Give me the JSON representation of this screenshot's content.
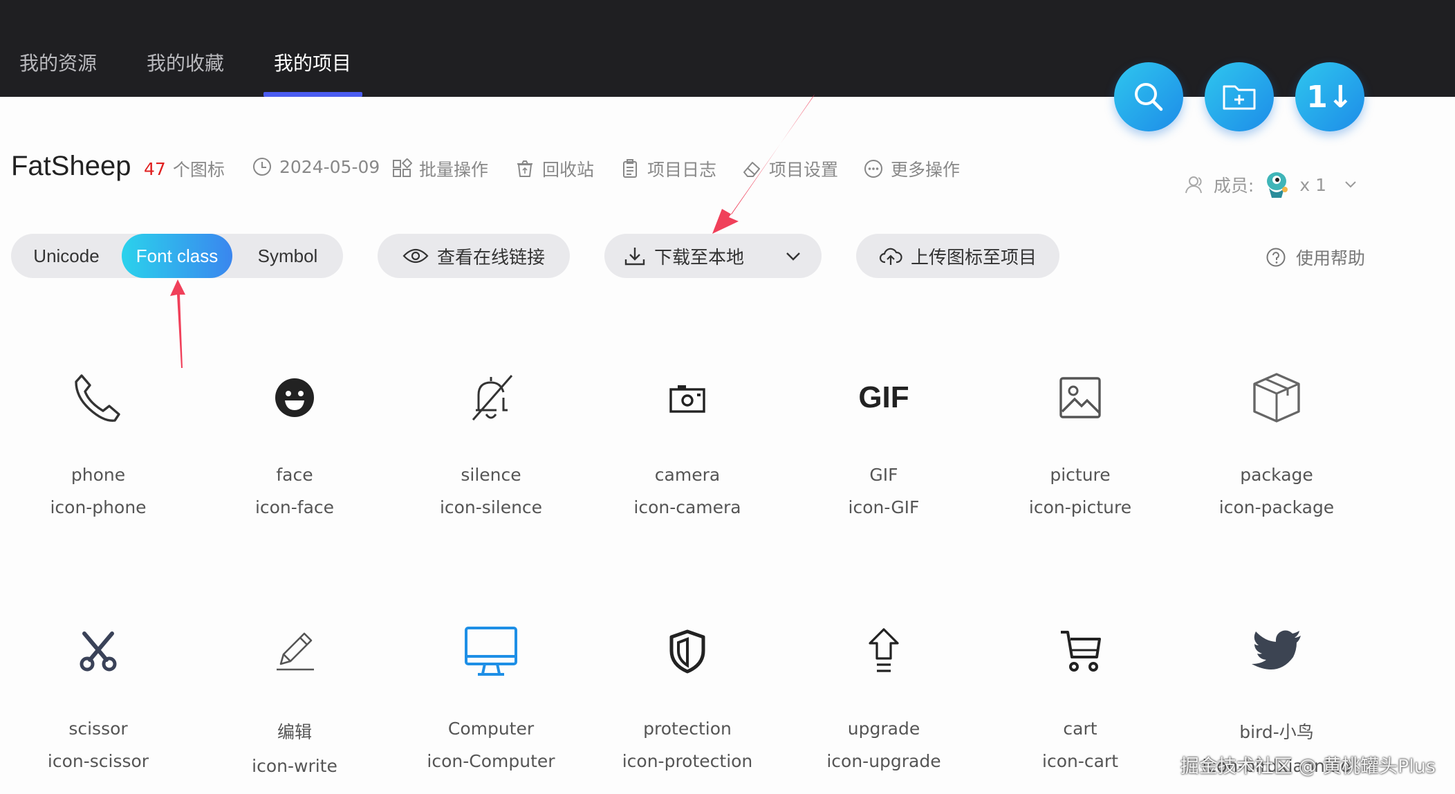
{
  "nav": {
    "tabs": [
      {
        "label": "我的资源"
      },
      {
        "label": "我的收藏"
      },
      {
        "label": "我的项目"
      }
    ],
    "active_tab": "我的项目"
  },
  "fab": {
    "search_icon": "search-icon",
    "new_folder_icon": "folder-plus-icon",
    "sort_icon": "sort-icon",
    "sort_glyph": "1↓"
  },
  "project": {
    "name": "FatSheep",
    "icon_count": "47",
    "icon_count_suffix": "个图标",
    "date": "2024-05-09",
    "actions": {
      "batch": "批量操作",
      "recycle": "回收站",
      "log": "项目日志",
      "settings": "项目设置",
      "more": "更多操作"
    },
    "members_label": "成员:",
    "members_count": "x 1"
  },
  "toolbar": {
    "segments": [
      "Unicode",
      "Font class",
      "Symbol"
    ],
    "active_segment": "Font class",
    "view_links": "查看在线链接",
    "download": "下载至本地",
    "upload": "上传图标至项目",
    "help": "使用帮助"
  },
  "icons": [
    {
      "name": "phone",
      "class": "icon-phone",
      "glyph": "phone-icon"
    },
    {
      "name": "face",
      "class": "icon-face",
      "glyph": "face-icon"
    },
    {
      "name": "silence",
      "class": "icon-silence",
      "glyph": "bell-off-icon"
    },
    {
      "name": "camera",
      "class": "icon-camera",
      "glyph": "camera-icon"
    },
    {
      "name": "GIF",
      "class": "icon-GIF",
      "glyph": "gif-icon",
      "text": "GIF"
    },
    {
      "name": "picture",
      "class": "icon-picture",
      "glyph": "picture-icon"
    },
    {
      "name": "package",
      "class": "icon-package",
      "glyph": "package-icon"
    },
    {
      "name": "scissor",
      "class": "icon-scissor",
      "glyph": "scissor-icon"
    },
    {
      "name": "编辑",
      "class": "icon-write",
      "glyph": "pencil-icon"
    },
    {
      "name": "Computer",
      "class": "icon-Computer",
      "glyph": "monitor-icon"
    },
    {
      "name": "protection",
      "class": "icon-protection",
      "glyph": "shield-icon"
    },
    {
      "name": "upgrade",
      "class": "icon-upgrade",
      "glyph": "upgrade-arrow-icon"
    },
    {
      "name": "cart",
      "class": "icon-cart",
      "glyph": "cart-icon"
    },
    {
      "name": "bird-小鸟",
      "class": "icon-birdxiaoniao",
      "glyph": "bird-icon"
    }
  ],
  "colors": {
    "topbar": "#1f1f22",
    "accent": "#4a5cf0",
    "fab_gradient_start": "#2fc6ee",
    "fab_gradient_end": "#1d8ce8",
    "icon_count": "#e02020",
    "annotation_arrow": "#f0405a",
    "computer_icon": "#1e8fe6"
  },
  "watermark": "掘金技术社区 @ 黄桃罐头Plus"
}
